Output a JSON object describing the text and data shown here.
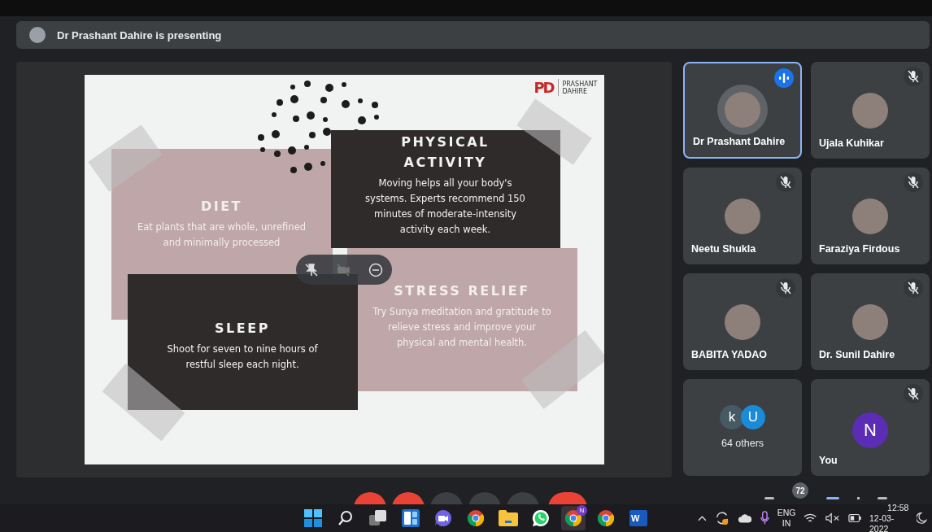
{
  "banner": {
    "text": "Dr Prashant Dahire is presenting"
  },
  "slide": {
    "logo": {
      "mark": "PD",
      "name_lines": [
        "PRASHANT",
        "DAHIRE"
      ]
    },
    "cards": [
      {
        "kind": "light",
        "title": "DIET",
        "body": "Eat plants that are whole, unrefined and minimally processed"
      },
      {
        "kind": "dark",
        "title": "PHYSICAL ACTIVITY",
        "body": "Moving helps all your body's systems. Experts recommend 150 minutes of moderate-intensity activity each week."
      },
      {
        "kind": "light",
        "title": "STRESS RELIEF",
        "body": "Try Sunya meditation and gratitude to relieve stress and improve your physical and mental health."
      },
      {
        "kind": "dark",
        "title": "SLEEP",
        "body": "Shoot for seven to nine hours of restful sleep each night."
      }
    ]
  },
  "participants": [
    {
      "kind": "photo",
      "name": "Dr Prashant Dahire",
      "selected": true,
      "muted": false,
      "speaking": true
    },
    {
      "kind": "photo",
      "name": "Ujala Kuhikar",
      "selected": false,
      "muted": true,
      "speaking": false
    },
    {
      "kind": "photo",
      "name": "Neetu Shukla",
      "selected": false,
      "muted": true,
      "speaking": false
    },
    {
      "kind": "photo",
      "name": "Faraziya Firdous",
      "selected": false,
      "muted": true,
      "speaking": false
    },
    {
      "kind": "photo",
      "name": "BABITA YADAO",
      "selected": false,
      "muted": true,
      "speaking": false
    },
    {
      "kind": "photo",
      "name": "Dr. Sunil Dahire",
      "selected": false,
      "muted": true,
      "speaking": false
    },
    {
      "kind": "others",
      "name": "64 others",
      "selected": false,
      "muted": false,
      "speaking": false,
      "avatars": [
        {
          "initial": "k",
          "color": "#455a64"
        },
        {
          "initial": "U",
          "color": "#1a8bd6"
        }
      ]
    },
    {
      "kind": "letter",
      "name": "You",
      "selected": false,
      "muted": true,
      "speaking": false,
      "initial": "N",
      "color": "#5b2db5"
    }
  ],
  "call_controls": [
    {
      "kind": "off"
    },
    {
      "kind": "off"
    },
    {
      "kind": "normal"
    },
    {
      "kind": "normal"
    },
    {
      "kind": "normal"
    },
    {
      "kind": "end"
    }
  ],
  "side_controls": {
    "badge": "72"
  },
  "taskbar": {
    "apps": [
      {
        "kind": "start",
        "selected": false
      },
      {
        "kind": "search",
        "selected": false
      },
      {
        "kind": "taskview",
        "selected": false
      },
      {
        "kind": "widgets",
        "selected": false
      },
      {
        "kind": "teams",
        "selected": false
      },
      {
        "kind": "chrome",
        "selected": false
      },
      {
        "kind": "folder",
        "selected": false
      },
      {
        "kind": "whatsapp",
        "selected": false
      },
      {
        "kind": "chrome",
        "selected": true,
        "badge": "N"
      },
      {
        "kind": "chrome",
        "selected": false
      },
      {
        "kind": "word",
        "selected": false,
        "label": "W"
      }
    ],
    "language": [
      "ENG",
      "IN"
    ],
    "time": "12:58",
    "date": "12-03-2022"
  }
}
